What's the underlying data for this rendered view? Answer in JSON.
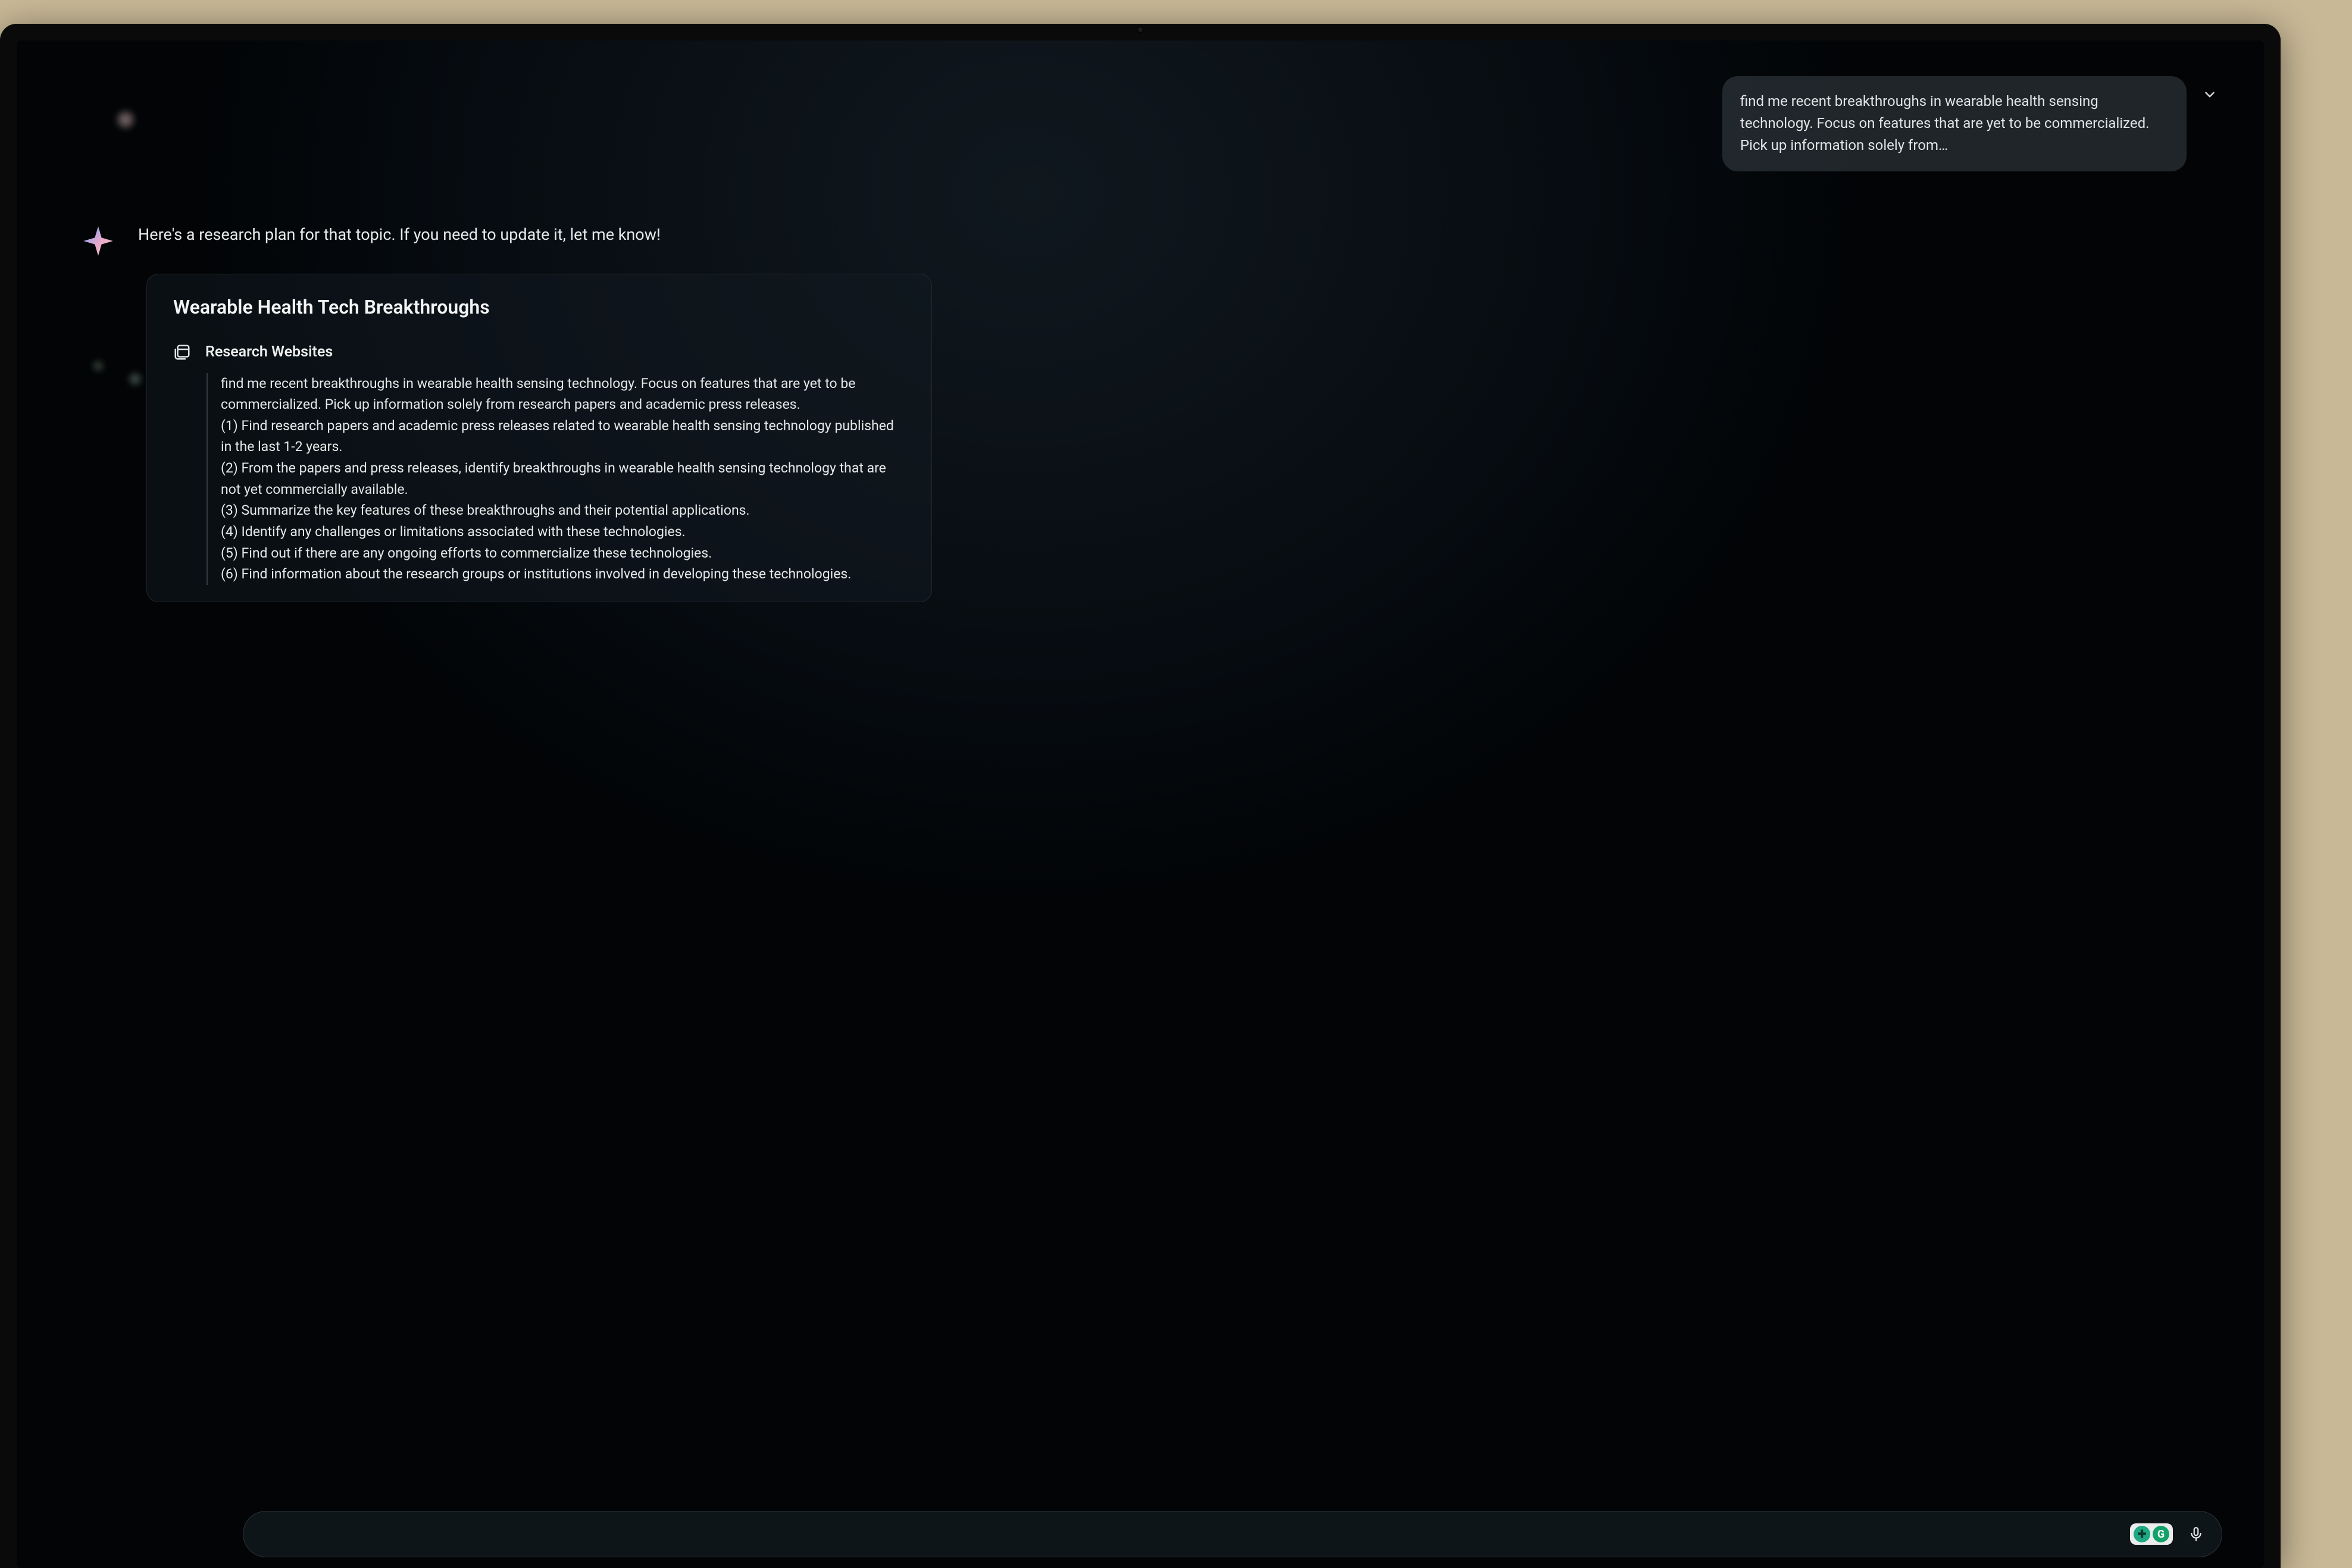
{
  "user_message": {
    "text": "find me recent breakthroughs in wearable health sensing technology. Focus on features that are yet to be commercialized. Pick up information solely from…"
  },
  "assistant_intro": "Here's a research plan for that topic. If you need to update it, let me know!",
  "plan": {
    "title": "Wearable Health Tech Breakthroughs",
    "section_heading": "Research Websites",
    "body": "find me recent breakthroughs in wearable health sensing technology. Focus on features that are yet to be commercialized. Pick up information solely from research papers and academic press releases.\n(1) Find research papers and academic press releases related to wearable health sensing technology published in the last 1-2 years.\n(2) From the papers and press releases, identify breakthroughs in wearable health sensing technology that are not yet commercially available.\n(3) Summarize the key features of these breakthroughs and their potential applications.\n(4) Identify any challenges or limitations associated with these technologies.\n(5) Find out if there are any ongoing efforts to commercialize these technologies.\n(6) Find information about the research groups or institutions involved in developing these technologies."
  },
  "icons": {
    "research_websites": "browser-stack-icon",
    "spark": "spark-icon",
    "chevron": "chevron-down-icon",
    "mic": "microphone-icon"
  },
  "badges": {
    "b1": "✚",
    "b2": "G"
  }
}
